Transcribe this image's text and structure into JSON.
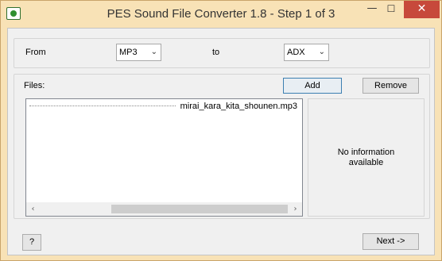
{
  "window": {
    "title": "PES Sound File Converter 1.8 - Step 1 of 3",
    "controls": {
      "minimize": "—",
      "maximize": "☐",
      "close": "✕"
    }
  },
  "conversion": {
    "from_label": "From",
    "from_value": "MP3",
    "to_label": "to",
    "to_value": "ADX"
  },
  "files": {
    "label": "Files:",
    "add_label": "Add",
    "remove_label": "Remove",
    "items": [
      "mirai_kara_kita_shounen.mp3"
    ]
  },
  "info": {
    "text_line1": "No information",
    "text_line2": "available"
  },
  "footer": {
    "help_label": "?",
    "next_label": "Next ->"
  }
}
